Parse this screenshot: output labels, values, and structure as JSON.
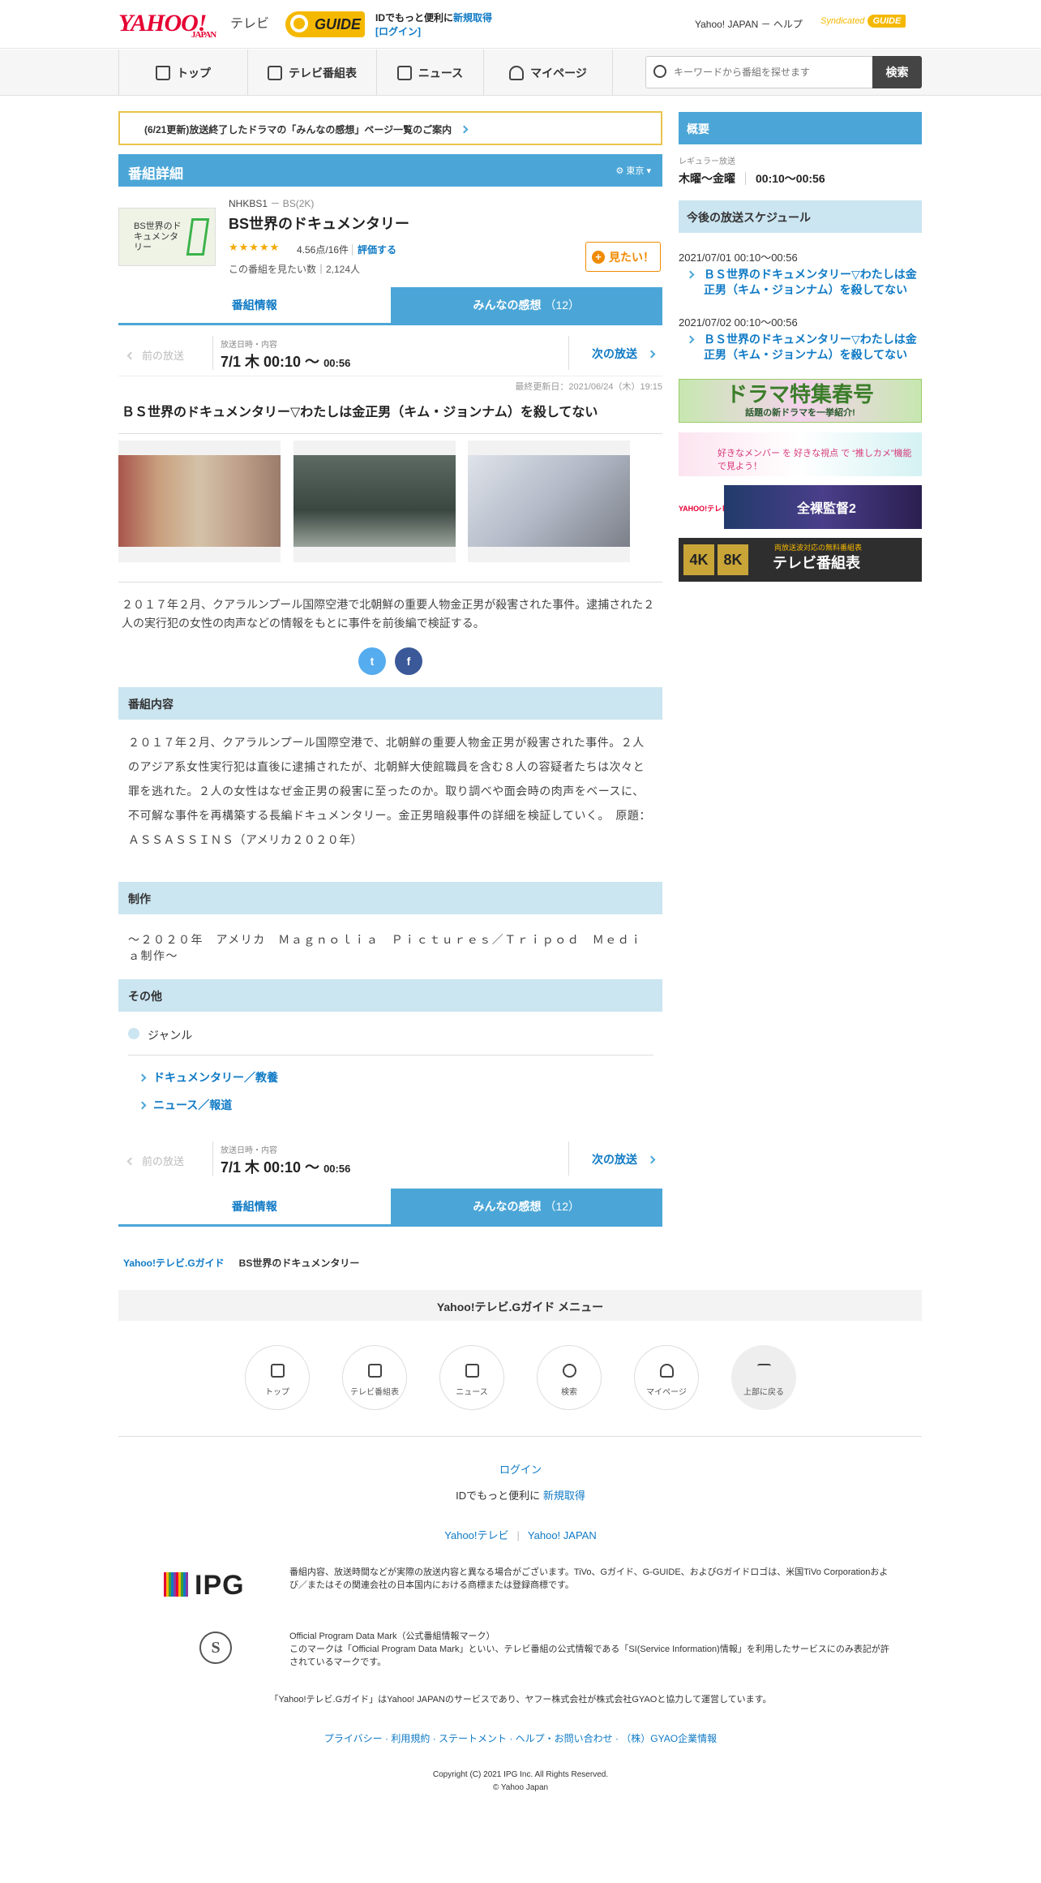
{
  "header": {
    "logo": "YAHOO!",
    "logo_sub": "JAPAN",
    "tv_label": "テレビ",
    "gguide_label": "GUIDE",
    "id_text": "IDでもっと便利に",
    "signup": "新規取得",
    "login": "[ログイン]",
    "right_links": "Yahoo! JAPAN － ヘルプ",
    "syndicated": "Syndicated",
    "syndicated_logo": "GUIDE"
  },
  "nav": {
    "items": [
      {
        "label": "トップ",
        "icon": "home-icon"
      },
      {
        "label": "テレビ番組表",
        "icon": "tv-icon"
      },
      {
        "label": "ニュース",
        "icon": "news-icon"
      },
      {
        "label": "マイページ",
        "icon": "user-icon"
      }
    ],
    "search_placeholder": "キーワードから番組を探せます",
    "search_button": "検索"
  },
  "notice": "(6/21更新)放送終了したドラマの「みんなの感想」ページ一覧のご案内",
  "detail": {
    "bar_title": "番組詳細",
    "region": "東京",
    "channel": "NHKBS1",
    "channel_sub": "－ BS(2K)",
    "title": "BS世界のドキュメンタリー",
    "stars": "★★★★★",
    "rating": "4.56点/16件",
    "rate_link": "評価する",
    "want_text": "この番組を見たい数｜2,124人",
    "want_button": "見たい！",
    "thumb_text": "BS世界のドキュメンタリー"
  },
  "tabs": {
    "info": "番組情報",
    "reviews": "みんなの感想",
    "reviews_count": "（12）"
  },
  "pager": {
    "prev": "前の放送",
    "label": "放送日時・内容",
    "date": "7/1  木  00:10 〜",
    "end": "00:56",
    "next": "次の放送"
  },
  "updated": "最終更新日：2021/06/24（木）19:15",
  "episode_title": "ＢＳ世界のドキュメンタリー▽わたしは金正男（キム・ジョンナム）を殺してない",
  "summary": "２０１７年２月、クアラルンプール国際空港で北朝鮮の重要人物金正男が殺害された事件。逮捕された２人の実行犯の女性の肉声などの情報をもとに事件を前後編で検証する。",
  "sections": {
    "content_title": "番組内容",
    "content": "２０１７年２月、クアラルンプール国際空港で、北朝鮮の重要人物金正男が殺害された事件。２人のアジア系女性実行犯は直後に逮捕されたが、北朝鮮大使館職員を含む８人の容疑者たちは次々と罪を逃れた。２人の女性はなぜ金正男の殺害に至ったのか。取り調べや面会時の肉声をベースに、不可解な事件を再構築する長編ドキュメンタリー。金正男暗殺事件の詳細を検証していく。　原題：ＡＳＳＡＳＳＩＮＳ（アメリカ２０２０年）",
    "production_title": "制作",
    "production": "〜２０２０年　アメリカ　Ｍａｇｎｏｌｉａ　Ｐｉｃｔｕｒｅｓ／Ｔｒｉｐｏｄ　Ｍｅｄｉａ制作〜",
    "other_title": "その他",
    "genre_label": "ジャンル",
    "genres": [
      "ドキュメンタリー／教養",
      "ニュース／報道"
    ]
  },
  "breadcrumb": {
    "home": "Yahoo!テレビ.Gガイド",
    "current": "BS世界のドキュメンタリー"
  },
  "sidebar": {
    "overview_title": "概要",
    "regular_label": "レギュラー放送",
    "regular_days": "木曜～金曜",
    "regular_time": "00:10～00:56",
    "schedule_title": "今後の放送スケジュール",
    "schedule": [
      {
        "date": "2021/07/01 00:10～00:56",
        "title": "ＢＳ世界のドキュメンタリー▽わたしは金正男（キム・ジョンナム）を殺してない"
      },
      {
        "date": "2021/07/02 00:10～00:56",
        "title": "ＢＳ世界のドキュメンタリー▽わたしは金正男（キム・ジョンナム）を殺してない"
      }
    ],
    "banners": {
      "b1_main": "ドラマ特集春号",
      "b1_sub": "話題の新ドラマを一挙紹介!",
      "b2": "好きなメンバー を 好きな視点 で “推しカメ”機能 で見よう！",
      "b3_logo": "YAHOO!テレビ",
      "b3": "全裸監督2",
      "b4_4k": "4K",
      "b4_8k": "8K",
      "b4": "テレビ番組表",
      "b4_small": "両放送波対応の無料番組表"
    }
  },
  "footer": {
    "menu_title": "Yahoo!テレビ.Gガイド メニュー",
    "menu": [
      "トップ",
      "テレビ番組表",
      "ニュース",
      "検索",
      "マイページ",
      "上部に戻る"
    ],
    "login": "ログイン",
    "id_text": "IDでもっと便利に",
    "signup": "新規取得",
    "link1": "Yahoo!テレビ",
    "link2": "Yahoo! JAPAN",
    "ipg": "IPG",
    "ipg_text": "番組内容、放送時間などが実際の放送内容と異なる場合がございます。TiVo、Gガイド、G-GUIDE、およびGガイドロゴは、米国TiVo Corporationおよび／またはその関連会社の日本国内における商標または登録商標です。",
    "seal": "S",
    "opdm_title": "Official Program Data Mark（公式番組情報マーク）",
    "opdm_text": "このマークは「Official Program Data Mark」といい、テレビ番組の公式情報である「SI(Service Information)情報」を利用したサービスにのみ表記が許されているマークです。",
    "operated": "「Yahoo!テレビ.Gガイド」はYahoo! JAPANのサービスであり、ヤフー株式会社が株式会社GYAOと協力して運営しています。",
    "policy": "プライバシー · 利用規約 · ステートメント · ヘルプ・お問い合わせ · （株）GYAO企業情報",
    "copyright": "Copyright (C) 2021 IPG Inc. All Rights Reserved.",
    "copyright2": "© Yahoo Japan"
  }
}
